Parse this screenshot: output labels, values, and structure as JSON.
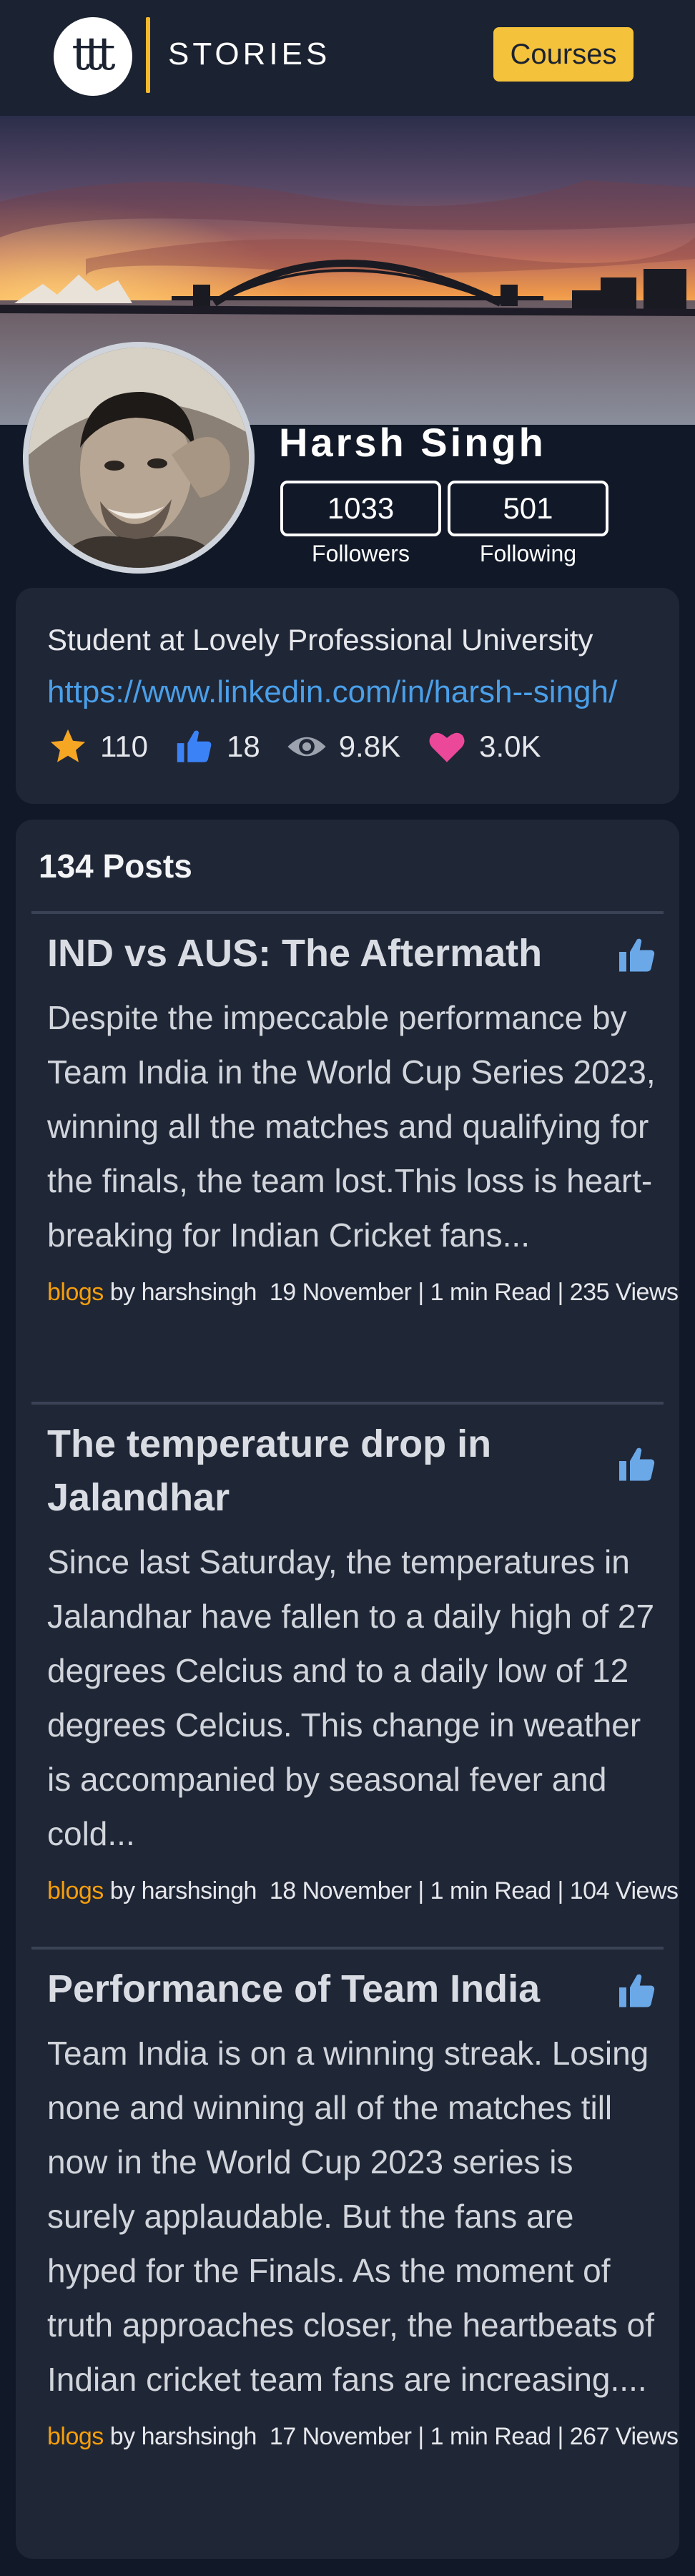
{
  "header": {
    "logo_mark": "ttt",
    "logo_text": "STORIES",
    "courses_label": "Courses",
    "accent_color": "#f5c23b"
  },
  "profile": {
    "name": "Harsh Singh",
    "followers_count": "1033",
    "followers_label": "Followers",
    "following_count": "501",
    "following_label": "Following"
  },
  "info": {
    "bio": "Student at Lovely Professional University",
    "link": "https://www.linkedin.com/in/harsh--singh/",
    "stats": [
      {
        "icon": "star-icon",
        "value": "110"
      },
      {
        "icon": "thumbs-up-icon",
        "value": "18"
      },
      {
        "icon": "eye-icon",
        "value": "9.8K"
      },
      {
        "icon": "heart-icon",
        "value": "3.0K"
      }
    ]
  },
  "posts": {
    "count_label": "134 Posts",
    "items": [
      {
        "title": "IND vs AUS: The Aftermath",
        "body": "Despite the impeccable performance by Team India in the World Cup Series 2023, winning all the matches and qualifying for the finals, the team lost.This loss is heart-breaking for Indian Cricket fans...",
        "category": "blogs",
        "author": " by harshsingh",
        "details": "19 November | 1 min Read | 235 Views"
      },
      {
        "title": "The temperature drop in Jalandhar",
        "body": "Since last Saturday, the temperatures in Jalandhar have fallen to a daily high of 27 degrees Celcius and to a daily low of 12 degrees Celcius. This change in weather is accompanied by seasonal fever and cold...",
        "category": "blogs",
        "author": " by harshsingh",
        "details": "18 November | 1 min Read | 104 Views"
      },
      {
        "title": "Performance of Team India",
        "body": "Team India is on a winning streak. Losing none and winning all of the matches till now in the World Cup 2023 series is surely applaudable. But the fans are hyped for the Finals. As the moment of truth approaches closer, the heartbeats of Indian cricket team fans are increasing....",
        "category": "blogs",
        "author": " by harshsingh",
        "details": "17 November | 1 min Read | 267 Views"
      }
    ]
  }
}
